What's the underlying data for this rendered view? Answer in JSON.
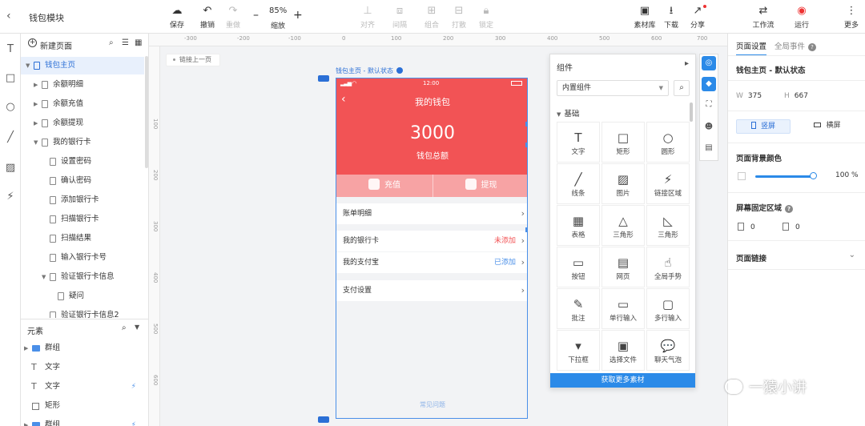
{
  "app": {
    "back_icon": "chevron-left-icon",
    "title": "钱包模块"
  },
  "toolbar": {
    "save": "保存",
    "undo": "撤销",
    "redo": "重做",
    "zoom_value": "85%",
    "zoom_label": "缩放",
    "align": "对齐",
    "distribute": "间隔",
    "group": "组合",
    "ungroup": "打散",
    "lock": "锁定",
    "asset_lib": "素材库",
    "download": "下载",
    "share": "分享",
    "workflow": "工作流",
    "run": "运行",
    "more": "更多"
  },
  "pages": {
    "new_page": "新建页面",
    "items": [
      "钱包主页",
      "余额明细",
      "余额充值",
      "余额提现",
      "我的银行卡",
      "设置密码",
      "确认密码",
      "添加银行卡",
      "扫描银行卡",
      "扫描结果",
      "输入银行卡号",
      "验证银行卡信息",
      "疑问",
      "验证银行卡信息2"
    ]
  },
  "elements": {
    "title": "元素",
    "items": [
      "群组",
      "文字",
      "文字",
      "矩形",
      "群组"
    ]
  },
  "ruler": {
    "top": [
      "-300",
      "-200",
      "-100",
      "0",
      "100",
      "200",
      "300",
      "400",
      "500",
      "600",
      "700"
    ],
    "left": [
      "100",
      "200",
      "300",
      "400",
      "500",
      "600"
    ]
  },
  "canvas": {
    "link_prev": "链接上一页",
    "state_label": "钱包主页 - 默认状态"
  },
  "phone": {
    "time": "12:00",
    "nav_title": "我的钱包",
    "amount": "3000",
    "amount_label": "钱包总额",
    "recharge": "充值",
    "withdraw": "提现",
    "rows": [
      {
        "label": "账单明细",
        "value": ""
      },
      {
        "label": "我的银行卡",
        "value": "未添加"
      },
      {
        "label": "我的支付宝",
        "value": "已添加"
      },
      {
        "label": "支付设置",
        "value": ""
      }
    ],
    "bottom_link": "常见问题",
    "colors": {
      "hero": "#f25355",
      "unadded": "#f25355",
      "added": "#4a8fe8"
    }
  },
  "components": {
    "title": "组件",
    "source": "内置组件",
    "section": "基础",
    "items": [
      {
        "glyph": "T",
        "label": "文字"
      },
      {
        "glyph": "□",
        "label": "矩形"
      },
      {
        "glyph": "○",
        "label": "圆形"
      },
      {
        "glyph": "╱",
        "label": "线条"
      },
      {
        "glyph": "▨",
        "label": "图片"
      },
      {
        "glyph": "⚡",
        "label": "链接区域"
      },
      {
        "glyph": "▦",
        "label": "表格"
      },
      {
        "glyph": "△",
        "label": "三角形"
      },
      {
        "glyph": "◺",
        "label": "三角形"
      },
      {
        "glyph": "▭",
        "label": "按钮"
      },
      {
        "glyph": "▤",
        "label": "网页"
      },
      {
        "glyph": "☝",
        "label": "全局手势"
      },
      {
        "glyph": "✎",
        "label": "批注"
      },
      {
        "glyph": "▭",
        "label": "单行输入"
      },
      {
        "glyph": "▢",
        "label": "多行输入"
      },
      {
        "glyph": "▾",
        "label": "下拉框"
      },
      {
        "glyph": "▣",
        "label": "选择文件"
      },
      {
        "glyph": "💬",
        "label": "聊天气泡"
      }
    ],
    "footer": "获取更多素材"
  },
  "props": {
    "tab_page": "页面设置",
    "tab_global": "全局事件",
    "page_title": "钱包主页 - 默认状态",
    "w_label": "W",
    "w": "375",
    "h_label": "H",
    "h": "667",
    "portrait": "竖屏",
    "landscape": "横屏",
    "bg_label": "页面背景颜色",
    "opacity": "100 %",
    "fixed_label": "屏幕固定区域",
    "fixed_top": "0",
    "fixed_bottom": "0",
    "page_link": "页面链接"
  },
  "watermark": "一猿小讲"
}
